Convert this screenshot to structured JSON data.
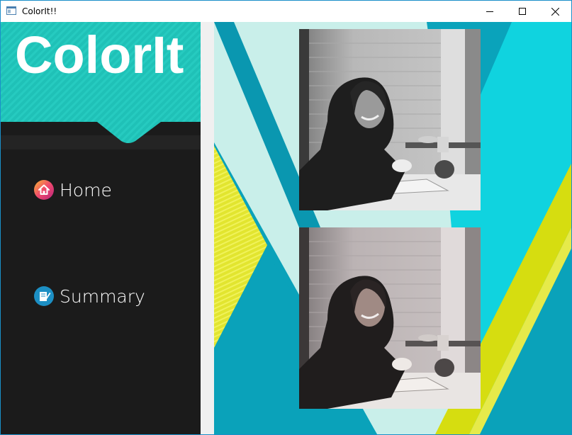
{
  "window": {
    "title": "ColorIt!!",
    "controls": [
      "minimize",
      "maximize",
      "close"
    ]
  },
  "sidebar": {
    "logo": "ColorIt",
    "items": [
      {
        "label": "Home",
        "icon": "home-icon"
      },
      {
        "label": "Summary",
        "icon": "summary-icon"
      }
    ]
  },
  "main": {
    "images": [
      {
        "name": "input-photo",
        "style": "grayscale"
      },
      {
        "name": "colorized-photo",
        "style": "colorized"
      }
    ]
  },
  "colors": {
    "teal": "#1fc1b7",
    "dark": "#1b1b1b",
    "cyan": "#0fd0de",
    "blue": "#0a9fb8",
    "yellow": "#d9df12"
  }
}
